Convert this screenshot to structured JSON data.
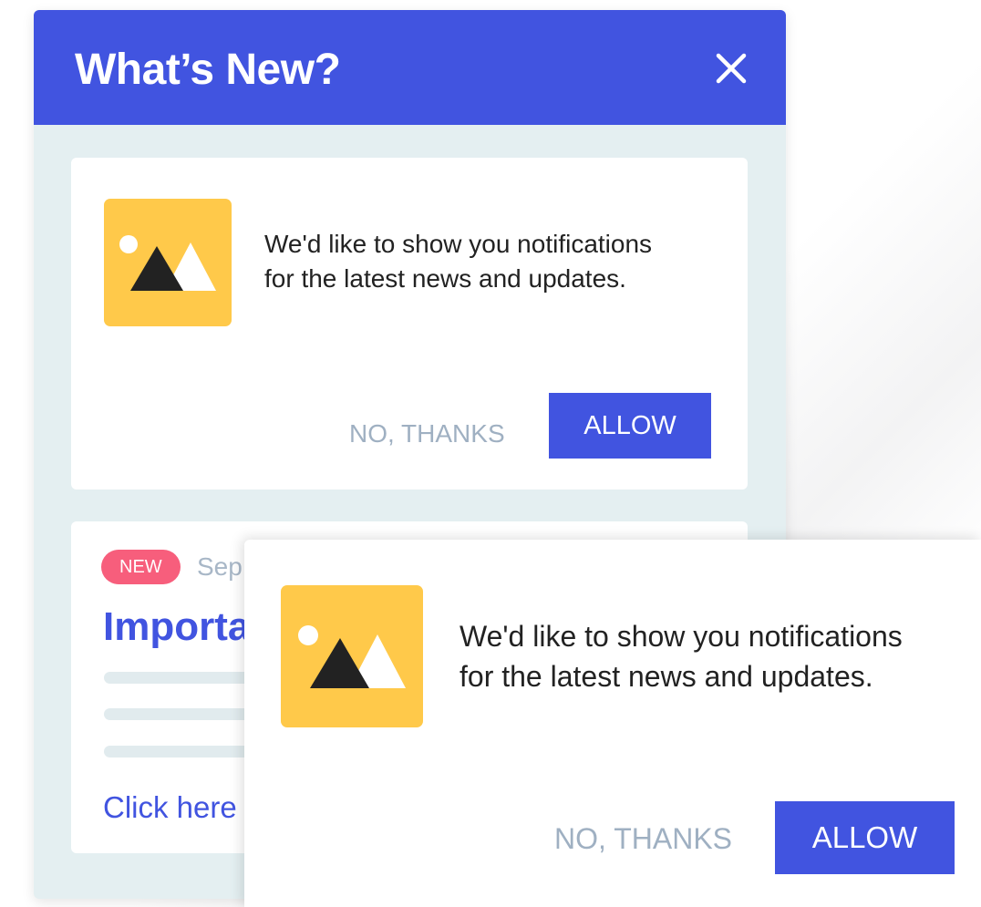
{
  "panel": {
    "title": "What’s New?",
    "close_icon": "close-icon",
    "header_color": "#4154e0",
    "background_color": "#e4eff1"
  },
  "permission_card": {
    "image_icon": "image-placeholder-icon",
    "message_line1": "We'd like to show you notifications",
    "message_line2": "for the latest news and updates.",
    "decline_label": "NO, THANKS",
    "allow_label": "ALLOW"
  },
  "news_card": {
    "badge": "NEW",
    "date": "Sep",
    "title": "Importa",
    "link": "Click here",
    "badge_color": "#f75e7c"
  },
  "popup": {
    "image_icon": "image-placeholder-icon",
    "message_line1": "We'd like to show you notifications",
    "message_line2": "for the latest news and updates.",
    "decline_label": "NO, THANKS",
    "allow_label": "ALLOW"
  },
  "colors": {
    "accent": "#4154e0",
    "thumb": "#ffc94a",
    "muted_text": "#9fb0c2"
  }
}
